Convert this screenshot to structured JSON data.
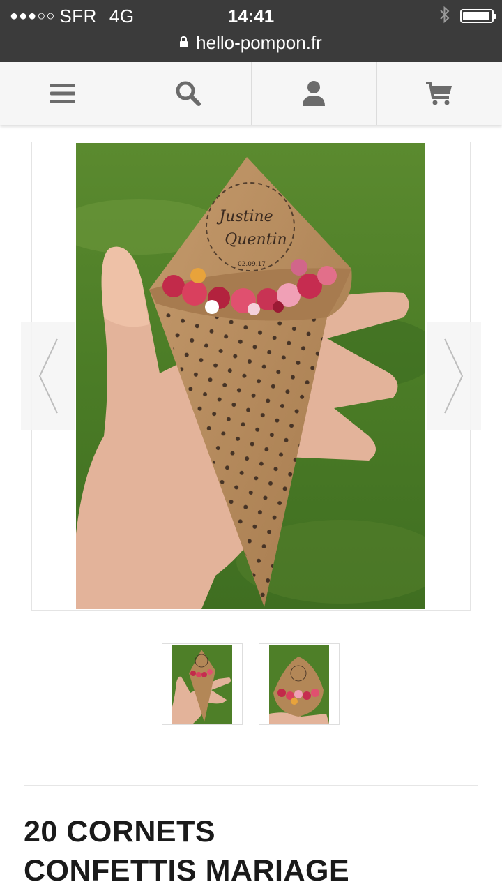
{
  "status_bar": {
    "signal": "●●●○○",
    "carrier": "SFR",
    "network": "4G",
    "time": "14:41"
  },
  "address_bar": {
    "url": "hello-pompon.fr"
  },
  "nav": {
    "items": [
      {
        "icon": "menu-icon"
      },
      {
        "icon": "search-icon"
      },
      {
        "icon": "user-icon"
      },
      {
        "icon": "cart-icon"
      }
    ]
  },
  "gallery": {
    "cone_text_line1": "Justine",
    "cone_text_line2": "Quentin",
    "cone_date": "02.09.17",
    "thumbnails": [
      {
        "alt": "cone-in-hand"
      },
      {
        "alt": "cone-filled"
      }
    ]
  },
  "product": {
    "title": "20 CORNETS\nCONFETTIS MARIAGE"
  },
  "colors": {
    "status_bg": "#3b3b3b",
    "nav_bg": "#f6f6f6",
    "icon": "#6b6b6b",
    "kraft": "#b5885a",
    "grass": "#4f7f2a"
  }
}
